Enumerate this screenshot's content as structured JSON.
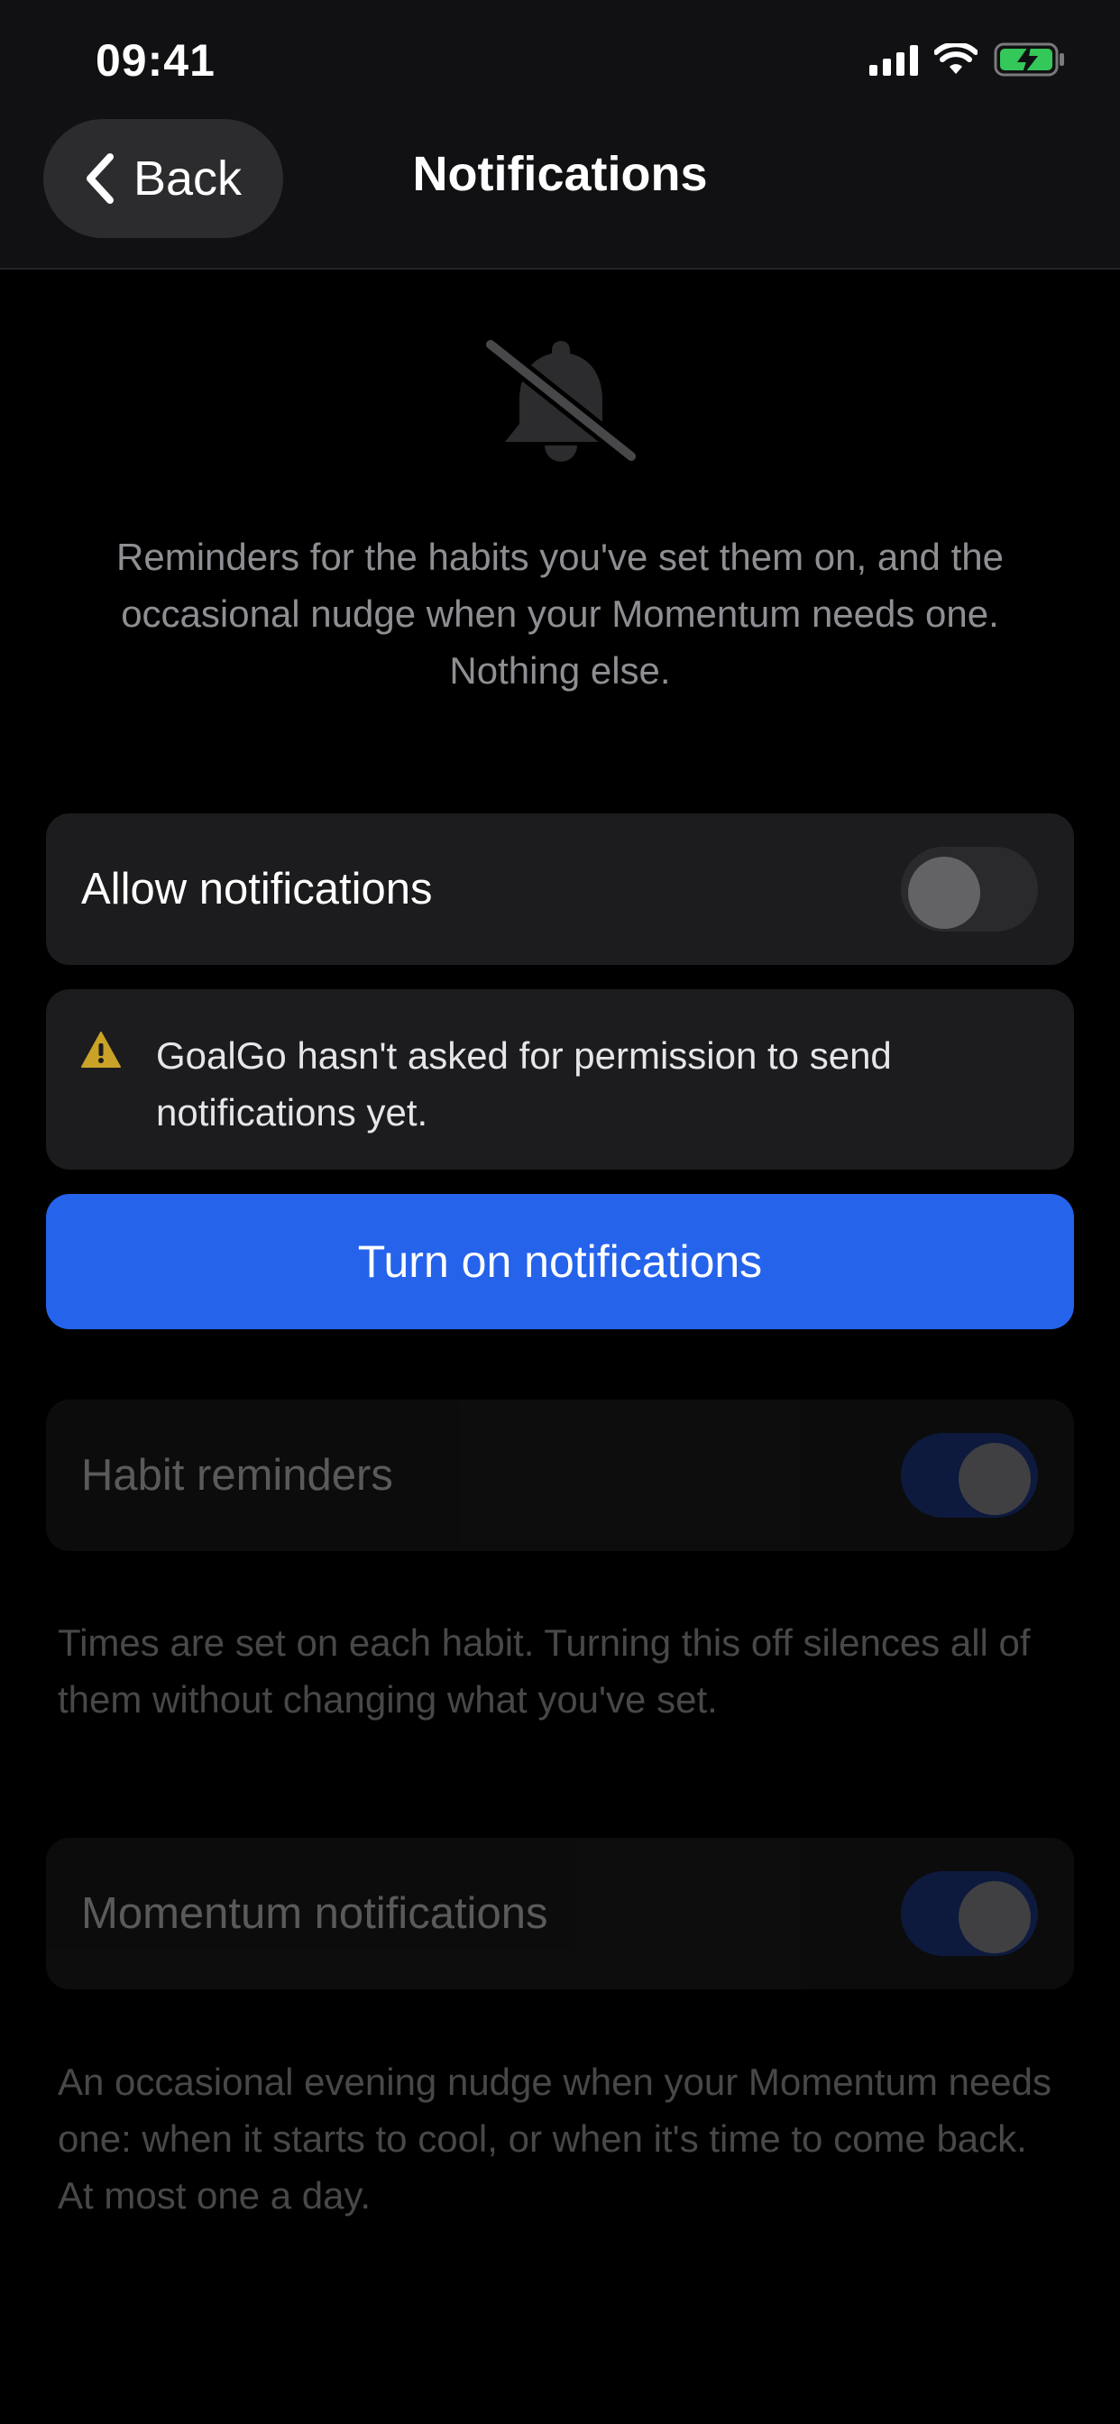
{
  "status_bar": {
    "time": "09:41",
    "icons": [
      "cellular-signal-icon",
      "wifi-icon",
      "battery-charging-icon"
    ]
  },
  "nav": {
    "back_label": "Back",
    "title": "Notifications"
  },
  "hero": {
    "icon": "bell-slash-icon",
    "description": "Reminders for the habits you've set them on, and the occasional nudge when your Momentum needs one. Nothing else."
  },
  "allow_notifications": {
    "label": "Allow notifications",
    "enabled": false
  },
  "permission_notice": {
    "icon": "warning-icon",
    "text": "GoalGo hasn't asked for permission to send notifications yet."
  },
  "turn_on_button": {
    "label": "Turn on notifications"
  },
  "habit_reminders": {
    "label": "Habit reminders",
    "enabled": true,
    "disabled_state": true,
    "footnote": "Times are set on each habit. Turning this off silences all of them without changing what you've set."
  },
  "momentum_notifications": {
    "label": "Momentum notifications",
    "enabled": true,
    "disabled_state": true,
    "footnote": "An occasional evening nudge when your Momentum needs one: when it starts to cool, or when it's time to come back. At most one a day."
  },
  "colors": {
    "accent": "#2563eb",
    "warning": "#f5c518",
    "charging_green": "#34c759"
  }
}
